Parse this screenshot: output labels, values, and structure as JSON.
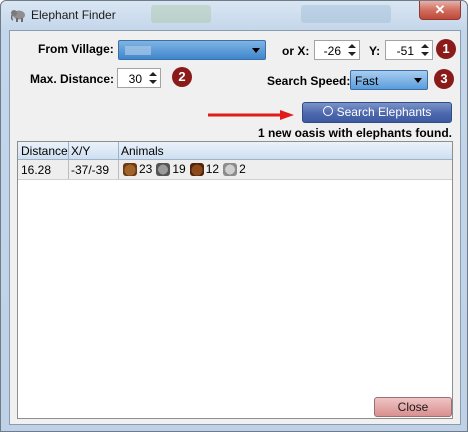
{
  "window": {
    "title": "Elephant Finder",
    "close_glyph": "✕"
  },
  "form": {
    "from_village_label": "From Village:",
    "or_x_label": "or X:",
    "x_value": "-26",
    "y_label": "Y:",
    "y_value": "-51",
    "max_distance_label": "Max. Distance:",
    "max_distance_value": "30",
    "search_speed_label": "Search Speed:",
    "search_speed_value": "Fast"
  },
  "badges": [
    "1",
    "2",
    "3"
  ],
  "search_button_label": "Search Elephants",
  "status_text": "1 new oasis with elephants found.",
  "table": {
    "columns": [
      "Distance",
      "X/Y",
      "Animals"
    ],
    "rows": [
      {
        "distance": "16.28",
        "xy": "-37/-39",
        "animals": [
          {
            "icon": "boar-icon",
            "count": "23"
          },
          {
            "icon": "elephant-icon",
            "count": "19"
          },
          {
            "icon": "bear-icon",
            "count": "12"
          },
          {
            "icon": "crocodile-icon",
            "count": "2"
          }
        ]
      }
    ]
  },
  "close_button_label": "Close",
  "colors": {
    "badge": "#8b1a1a",
    "arrow": "#e11b1b",
    "search_button": "#4d68ad",
    "close_button": "#d98f8f"
  }
}
